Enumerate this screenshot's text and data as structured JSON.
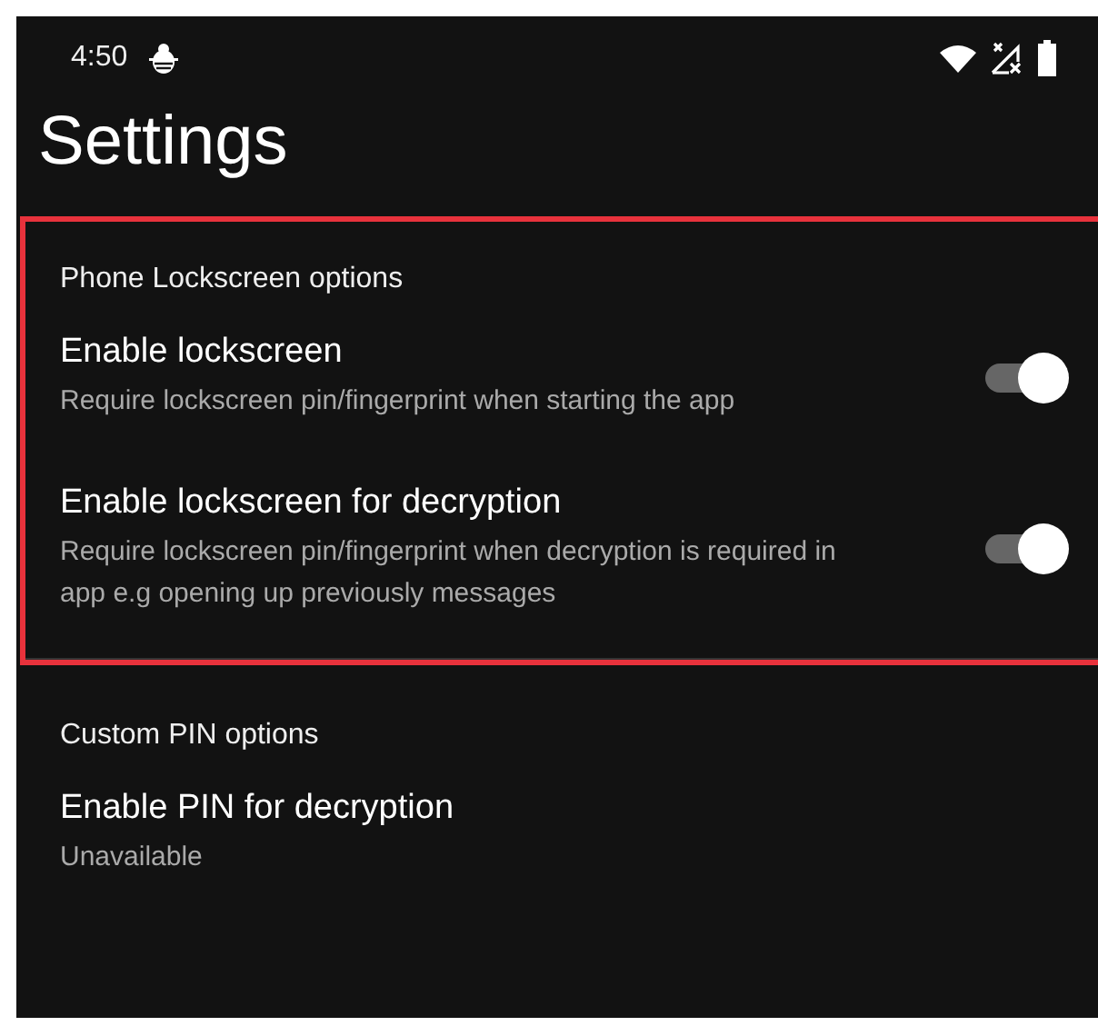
{
  "status_bar": {
    "time": "4:50"
  },
  "title": "Settings",
  "sections": [
    {
      "header": "Phone Lockscreen options",
      "highlighted": true,
      "items": [
        {
          "kind": "switch",
          "title": "Enable lockscreen",
          "summary": "Require lockscreen pin/fingerprint when starting the app",
          "on": true
        },
        {
          "kind": "switch",
          "title": "Enable lockscreen for decryption",
          "summary": "Require lockscreen pin/fingerprint when decryption is required in app e.g opening up previously messages",
          "on": true
        }
      ]
    },
    {
      "header": "Custom PIN options",
      "highlighted": false,
      "items": [
        {
          "kind": "plain",
          "title": "Enable PIN for decryption",
          "summary": "Unavailable"
        }
      ]
    }
  ]
}
